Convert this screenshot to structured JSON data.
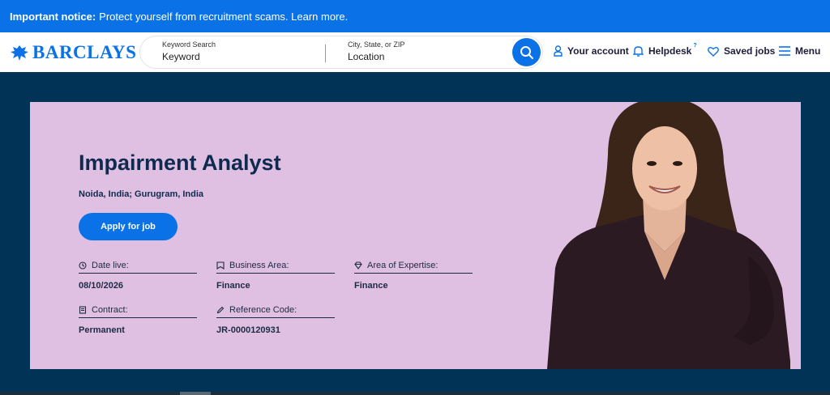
{
  "notice": {
    "bold": "Important notice:",
    "text": "Protect yourself from recruitment scams. Learn more."
  },
  "header": {
    "logo_text": "BARCLAYS",
    "search": {
      "keyword_label": "Keyword Search",
      "keyword_value": "Keyword",
      "location_label": "City, State, or ZIP",
      "location_value": "Location"
    },
    "nav": {
      "account": "Your account",
      "helpdesk": "Helpdesk",
      "helpdesk_sup": "?",
      "saved": "Saved jobs",
      "menu": "Menu"
    }
  },
  "job": {
    "title": "Impairment Analyst",
    "locations": "Noida, India; Gurugram, India",
    "apply_label": "Apply for job",
    "fields": {
      "date_live": {
        "label": "Date live:",
        "value": "08/10/2026"
      },
      "business_area": {
        "label": "Business Area:",
        "value": "Finance"
      },
      "area_of_expertise": {
        "label": "Area of Expertise:",
        "value": "Finance"
      },
      "contract": {
        "label": "Contract:",
        "value": "Permanent"
      },
      "reference_code": {
        "label": "Reference Code:",
        "value": "JR-0000120931"
      }
    }
  },
  "icons": [
    "eagle-logo-icon",
    "search-icon",
    "person-icon",
    "bell-icon",
    "heart-icon",
    "hamburger-icon",
    "clock-icon",
    "flag-icon",
    "diamond-icon",
    "document-icon",
    "pencil-icon"
  ],
  "colors": {
    "brand_blue": "#0a72e6",
    "navy": "#003356",
    "banner_pink": "#e0c0e2",
    "text_dark": "#0e2a4f"
  }
}
